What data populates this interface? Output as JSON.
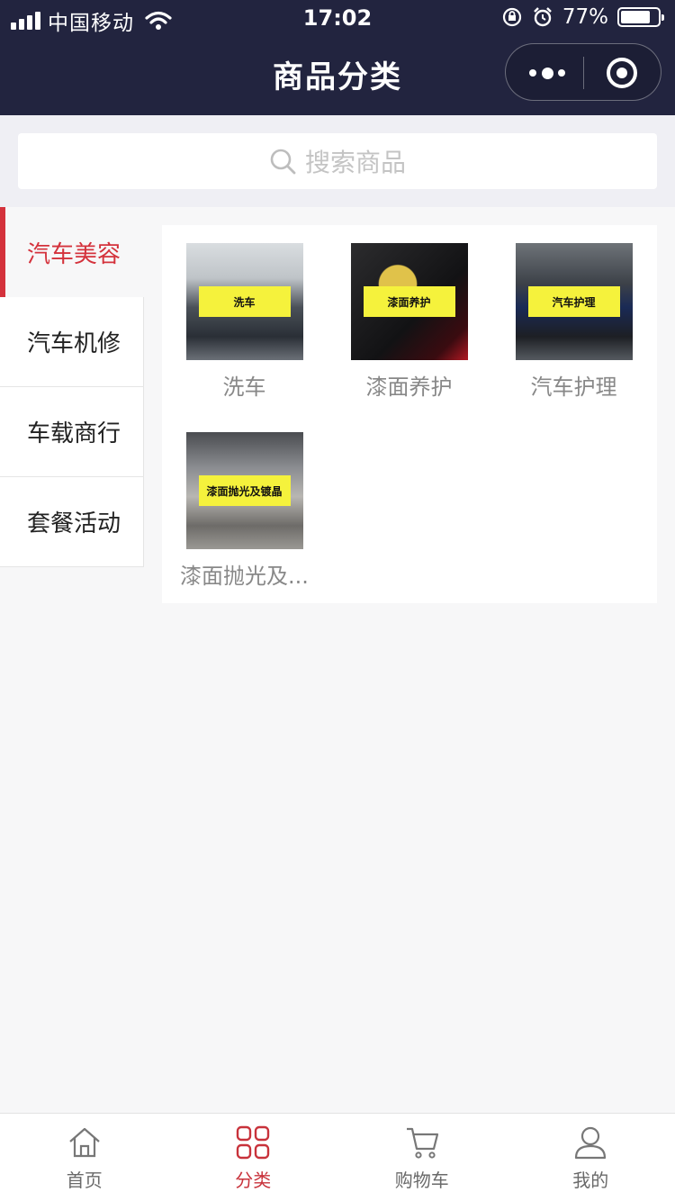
{
  "status": {
    "carrier": "中国移动",
    "time": "17:02",
    "battery": "77%"
  },
  "nav": {
    "title": "商品分类"
  },
  "search": {
    "placeholder": "搜索商品"
  },
  "categories": [
    {
      "label": "汽车美容",
      "active": true
    },
    {
      "label": "汽车机修",
      "active": false
    },
    {
      "label": "车载商行",
      "active": false
    },
    {
      "label": "套餐活动",
      "active": false
    }
  ],
  "products": [
    {
      "badge": "洗车",
      "name": "洗车"
    },
    {
      "badge": "漆面养护",
      "name": "漆面养护"
    },
    {
      "badge": "汽车护理",
      "name": "汽车护理"
    },
    {
      "badge": "漆面抛光及镀晶",
      "name": "漆面抛光及..."
    }
  ],
  "tabs": [
    {
      "label": "首页",
      "icon": "home-icon",
      "active": false
    },
    {
      "label": "分类",
      "icon": "category-icon",
      "active": true
    },
    {
      "label": "购物车",
      "icon": "cart-icon",
      "active": false
    },
    {
      "label": "我的",
      "icon": "user-icon",
      "active": false
    }
  ],
  "colors": {
    "header_bg": "#22243f",
    "accent": "#d4323c",
    "badge_bg": "#f5f23c"
  }
}
